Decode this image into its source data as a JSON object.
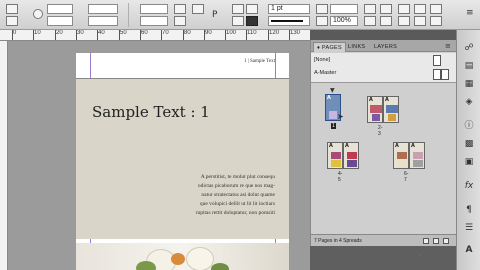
{
  "control_bar": {
    "stroke_weight": "1 pt",
    "zoom": "100%"
  },
  "ruler": {
    "ticks": [
      "0",
      "10",
      "20",
      "30",
      "40",
      "50",
      "60",
      "70",
      "80",
      "90",
      "100",
      "110",
      "120",
      "130"
    ]
  },
  "document": {
    "header": "1   |   Sample Text",
    "title": "Sample Text : 1",
    "body_lines": [
      "A perstitist, te molut plut consequ",
      "odictas picaborum re que nos mag-",
      "natur stratectatus asi dolut quame",
      "que volupici dellit ut lit lit inctiars",
      "rupitas rettit doluptatur, non pomsiti"
    ]
  },
  "pages_panel": {
    "tabs": [
      "♦ PAGES",
      "LINKS",
      "LAYERS"
    ],
    "masters": [
      "[None]",
      "A-Master"
    ],
    "spreads": [
      {
        "label": "1",
        "selected": true
      },
      {
        "label": "2-3",
        "selected": false
      },
      {
        "label": "4-5",
        "selected": false
      },
      {
        "label": "6-7",
        "selected": false
      }
    ],
    "status": "7 Pages in 4 Spreads"
  },
  "icons": {
    "tools": [
      "links-icon",
      "stroke-icon",
      "swatches-icon",
      "layers-icon",
      "info-icon",
      "gradient-icon",
      "effects-icon",
      "character-icon",
      "paragraph-icon",
      "text-wrap-icon",
      "pages-icon"
    ]
  },
  "colors": {
    "panel": "#cfcfcf",
    "pasteboard": "#9b9b9b",
    "page_tan": "#d9d5c8",
    "selection": "#222222"
  }
}
